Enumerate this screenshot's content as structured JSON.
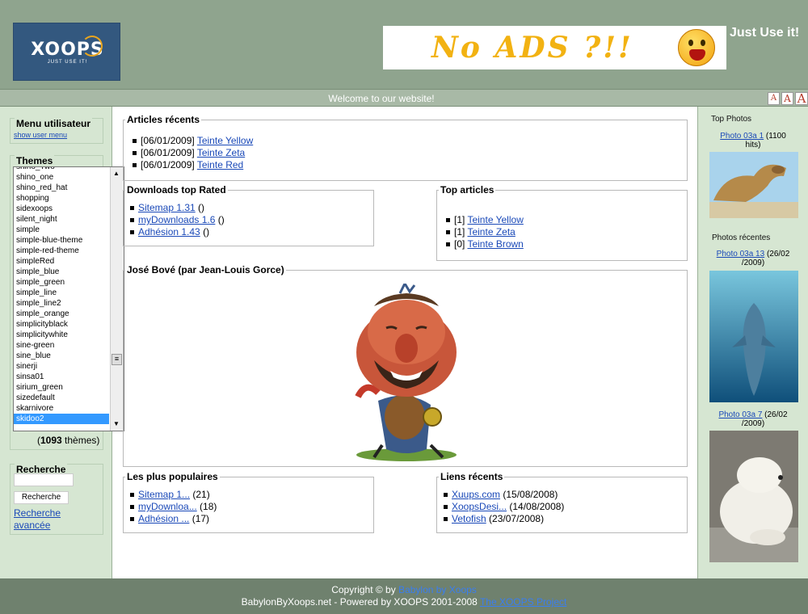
{
  "header": {
    "logo_text": "XOOPS",
    "logo_tagline": "JUST USE IT!",
    "banner_text": "No ADS ?!!",
    "slogan": "Just Use it!"
  },
  "welcome_bar": {
    "text": "Welcome to our website!",
    "font_sizes": [
      "A",
      "A",
      "A"
    ]
  },
  "left": {
    "user_menu": {
      "title": "Menu utilisateur",
      "link": "show user menu"
    },
    "themes": {
      "title": "Themes",
      "items": [
        "shino_Two",
        "shino_one",
        "shino_red_hat",
        "shopping",
        "sidexoops",
        "silent_night",
        "simple",
        "simple-blue-theme",
        "simple-red-theme",
        "simpleRed",
        "simple_blue",
        "simple_green",
        "simple_line",
        "simple_line2",
        "simple_orange",
        "simplicityblack",
        "simplicitywhite",
        "sine-green",
        "sine_blue",
        "sinerji",
        "sinsa01",
        "sirium_green",
        "sizedefault",
        "skarnivore",
        "skidoo2"
      ],
      "selected": "skidoo2",
      "count": "1093",
      "count_suffix": " thèmes"
    },
    "search": {
      "title": "Recherche",
      "button": "Recherche",
      "advanced_1": "Recherche",
      "advanced_2": "avancée"
    }
  },
  "center": {
    "recent_articles": {
      "title": "Articles récents",
      "items": [
        {
          "date": "[06/01/2009] ",
          "link": "Teinte Yellow"
        },
        {
          "date": "[06/01/2009] ",
          "link": "Teinte Zeta"
        },
        {
          "date": "[06/01/2009] ",
          "link": "Teinte Red"
        }
      ]
    },
    "downloads": {
      "title": "Downloads top Rated",
      "items": [
        {
          "link": "Sitemap 1.31",
          "suffix": " ()"
        },
        {
          "link": "myDownloads 1.6",
          "suffix": " ()"
        },
        {
          "link": "Adhésion 1.43",
          "suffix": " ()"
        }
      ]
    },
    "top_articles": {
      "title": "Top articles",
      "items": [
        {
          "count": "[1] ",
          "link": "Teinte Yellow"
        },
        {
          "count": "[1] ",
          "link": "Teinte Zeta"
        },
        {
          "count": "[0] ",
          "link": "Teinte Brown"
        }
      ]
    },
    "caricature": {
      "title": "José Bové (par Jean-Louis Gorce)"
    },
    "popular": {
      "title": "Les plus populaires",
      "items": [
        {
          "link": "Sitemap 1...",
          "suffix": " (21)"
        },
        {
          "link": "myDownloa...",
          "suffix": " (18)"
        },
        {
          "link": "Adhésion ...",
          "suffix": " (17)"
        }
      ]
    },
    "recent_links": {
      "title": "Liens récents",
      "items": [
        {
          "link": "Xuups.com",
          "suffix": " (15/08/2008)"
        },
        {
          "link": "XoopsDesi...",
          "suffix": " (14/08/2008)"
        },
        {
          "link": "Vetofish",
          "suffix": " (23/07/2008)"
        }
      ]
    }
  },
  "right": {
    "top_photos": {
      "title": "Top Photos",
      "link": "Photo 03a 1",
      "meta_1": " (1100",
      "meta_2": "hits)"
    },
    "recent_photos": {
      "title": "Photos récentes",
      "items": [
        {
          "link": "Photo 03a 13",
          "meta_1": " (26/02",
          "meta_2": "/2009)"
        },
        {
          "link": "Photo 03a 7",
          "meta_1": " (26/02",
          "meta_2": "/2009)"
        }
      ]
    }
  },
  "footer": {
    "copyright": "Copyright © by ",
    "copyright_link": "Babylon by Xoops",
    "powered": "BabylonByXoops.net - Powered by XOOPS 2001-2008 ",
    "powered_link": "The XOOPS Project"
  }
}
